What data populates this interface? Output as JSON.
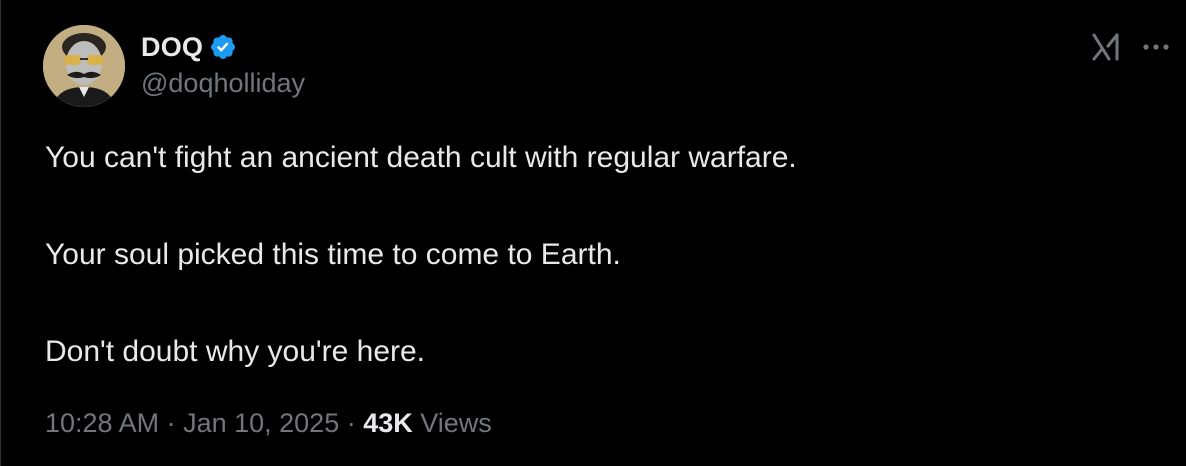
{
  "tweet": {
    "author": {
      "display_name": "DOQ",
      "handle": "@doqholliday",
      "verified": true,
      "avatar_icon": "avatar-mustache-sunglasses"
    },
    "text_lines": [
      "You can't fight an ancient death cult with regular warfare.",
      "Your soul picked this time to come to Earth.",
      "Don't doubt why you're here."
    ],
    "meta": {
      "time": "10:28 AM",
      "separator": " · ",
      "date": "Jan 10, 2025",
      "views_count": "43K",
      "views_label": " Views"
    }
  },
  "header_icons": {
    "grok": "grok-icon",
    "more": "more-options-icon"
  },
  "colors": {
    "background": "#000000",
    "text_primary": "#e7e9ea",
    "text_secondary": "#71767b",
    "verified_blue": "#1d9bf0"
  }
}
